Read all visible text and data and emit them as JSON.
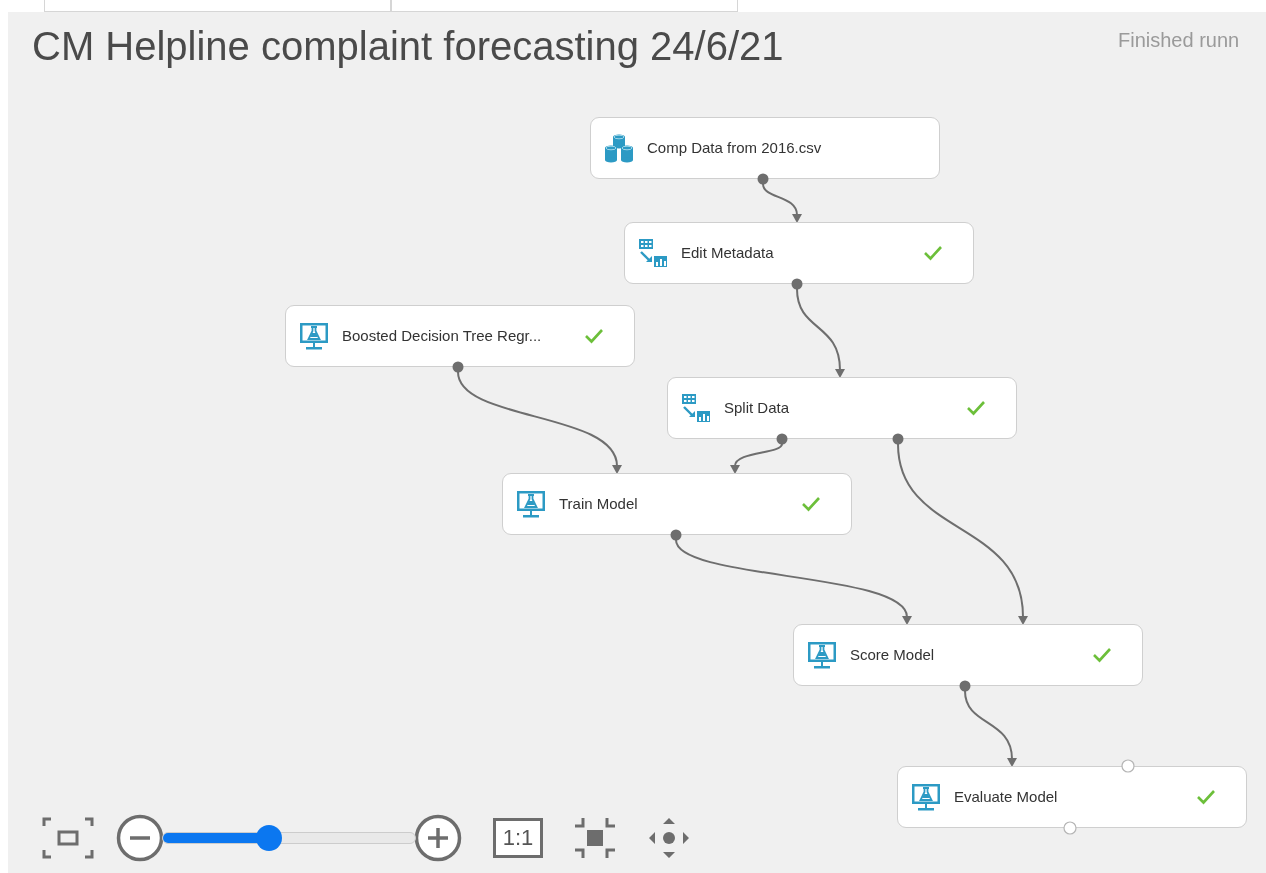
{
  "experiment": {
    "title": "CM Helpline complaint forecasting 24/6/21",
    "status": "Finished runn"
  },
  "nodes": [
    {
      "label": "Comp Data from 2016.csv",
      "kind": "dataset",
      "completed": false
    },
    {
      "label": "Edit Metadata",
      "kind": "transform",
      "completed": true
    },
    {
      "label": "Boosted Decision Tree Regr...",
      "kind": "model",
      "completed": true
    },
    {
      "label": "Split Data",
      "kind": "transform",
      "completed": true
    },
    {
      "label": "Train Model",
      "kind": "model",
      "completed": true
    },
    {
      "label": "Score Model",
      "kind": "model",
      "completed": true
    },
    {
      "label": "Evaluate Model",
      "kind": "model",
      "completed": true
    }
  ],
  "zoom": {
    "level": 0.42,
    "actual_size_label": "1:1"
  }
}
